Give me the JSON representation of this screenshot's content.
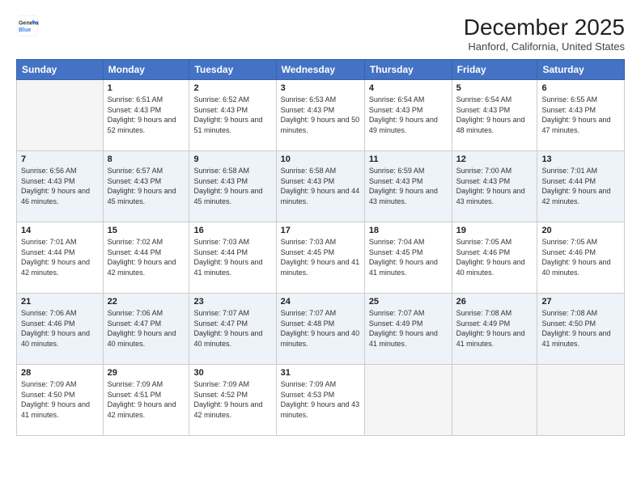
{
  "header": {
    "logo_line1": "General",
    "logo_line2": "Blue",
    "month": "December 2025",
    "location": "Hanford, California, United States"
  },
  "weekdays": [
    "Sunday",
    "Monday",
    "Tuesday",
    "Wednesday",
    "Thursday",
    "Friday",
    "Saturday"
  ],
  "weeks": [
    [
      {
        "day": "",
        "empty": true
      },
      {
        "day": "1",
        "sunrise": "6:51 AM",
        "sunset": "4:43 PM",
        "daylight": "9 hours and 52 minutes."
      },
      {
        "day": "2",
        "sunrise": "6:52 AM",
        "sunset": "4:43 PM",
        "daylight": "9 hours and 51 minutes."
      },
      {
        "day": "3",
        "sunrise": "6:53 AM",
        "sunset": "4:43 PM",
        "daylight": "9 hours and 50 minutes."
      },
      {
        "day": "4",
        "sunrise": "6:54 AM",
        "sunset": "4:43 PM",
        "daylight": "9 hours and 49 minutes."
      },
      {
        "day": "5",
        "sunrise": "6:54 AM",
        "sunset": "4:43 PM",
        "daylight": "9 hours and 48 minutes."
      },
      {
        "day": "6",
        "sunrise": "6:55 AM",
        "sunset": "4:43 PM",
        "daylight": "9 hours and 47 minutes."
      }
    ],
    [
      {
        "day": "7",
        "sunrise": "6:56 AM",
        "sunset": "4:43 PM",
        "daylight": "9 hours and 46 minutes."
      },
      {
        "day": "8",
        "sunrise": "6:57 AM",
        "sunset": "4:43 PM",
        "daylight": "9 hours and 45 minutes."
      },
      {
        "day": "9",
        "sunrise": "6:58 AM",
        "sunset": "4:43 PM",
        "daylight": "9 hours and 45 minutes."
      },
      {
        "day": "10",
        "sunrise": "6:58 AM",
        "sunset": "4:43 PM",
        "daylight": "9 hours and 44 minutes."
      },
      {
        "day": "11",
        "sunrise": "6:59 AM",
        "sunset": "4:43 PM",
        "daylight": "9 hours and 43 minutes."
      },
      {
        "day": "12",
        "sunrise": "7:00 AM",
        "sunset": "4:43 PM",
        "daylight": "9 hours and 43 minutes."
      },
      {
        "day": "13",
        "sunrise": "7:01 AM",
        "sunset": "4:44 PM",
        "daylight": "9 hours and 42 minutes."
      }
    ],
    [
      {
        "day": "14",
        "sunrise": "7:01 AM",
        "sunset": "4:44 PM",
        "daylight": "9 hours and 42 minutes."
      },
      {
        "day": "15",
        "sunrise": "7:02 AM",
        "sunset": "4:44 PM",
        "daylight": "9 hours and 42 minutes."
      },
      {
        "day": "16",
        "sunrise": "7:03 AM",
        "sunset": "4:44 PM",
        "daylight": "9 hours and 41 minutes."
      },
      {
        "day": "17",
        "sunrise": "7:03 AM",
        "sunset": "4:45 PM",
        "daylight": "9 hours and 41 minutes."
      },
      {
        "day": "18",
        "sunrise": "7:04 AM",
        "sunset": "4:45 PM",
        "daylight": "9 hours and 41 minutes."
      },
      {
        "day": "19",
        "sunrise": "7:05 AM",
        "sunset": "4:46 PM",
        "daylight": "9 hours and 40 minutes."
      },
      {
        "day": "20",
        "sunrise": "7:05 AM",
        "sunset": "4:46 PM",
        "daylight": "9 hours and 40 minutes."
      }
    ],
    [
      {
        "day": "21",
        "sunrise": "7:06 AM",
        "sunset": "4:46 PM",
        "daylight": "9 hours and 40 minutes."
      },
      {
        "day": "22",
        "sunrise": "7:06 AM",
        "sunset": "4:47 PM",
        "daylight": "9 hours and 40 minutes."
      },
      {
        "day": "23",
        "sunrise": "7:07 AM",
        "sunset": "4:47 PM",
        "daylight": "9 hours and 40 minutes."
      },
      {
        "day": "24",
        "sunrise": "7:07 AM",
        "sunset": "4:48 PM",
        "daylight": "9 hours and 40 minutes."
      },
      {
        "day": "25",
        "sunrise": "7:07 AM",
        "sunset": "4:49 PM",
        "daylight": "9 hours and 41 minutes."
      },
      {
        "day": "26",
        "sunrise": "7:08 AM",
        "sunset": "4:49 PM",
        "daylight": "9 hours and 41 minutes."
      },
      {
        "day": "27",
        "sunrise": "7:08 AM",
        "sunset": "4:50 PM",
        "daylight": "9 hours and 41 minutes."
      }
    ],
    [
      {
        "day": "28",
        "sunrise": "7:09 AM",
        "sunset": "4:50 PM",
        "daylight": "9 hours and 41 minutes."
      },
      {
        "day": "29",
        "sunrise": "7:09 AM",
        "sunset": "4:51 PM",
        "daylight": "9 hours and 42 minutes."
      },
      {
        "day": "30",
        "sunrise": "7:09 AM",
        "sunset": "4:52 PM",
        "daylight": "9 hours and 42 minutes."
      },
      {
        "day": "31",
        "sunrise": "7:09 AM",
        "sunset": "4:53 PM",
        "daylight": "9 hours and 43 minutes."
      },
      {
        "day": "",
        "empty": true
      },
      {
        "day": "",
        "empty": true
      },
      {
        "day": "",
        "empty": true
      }
    ]
  ],
  "labels": {
    "sunrise_prefix": "Sunrise: ",
    "sunset_prefix": "Sunset: ",
    "daylight_label": "Daylight: "
  }
}
